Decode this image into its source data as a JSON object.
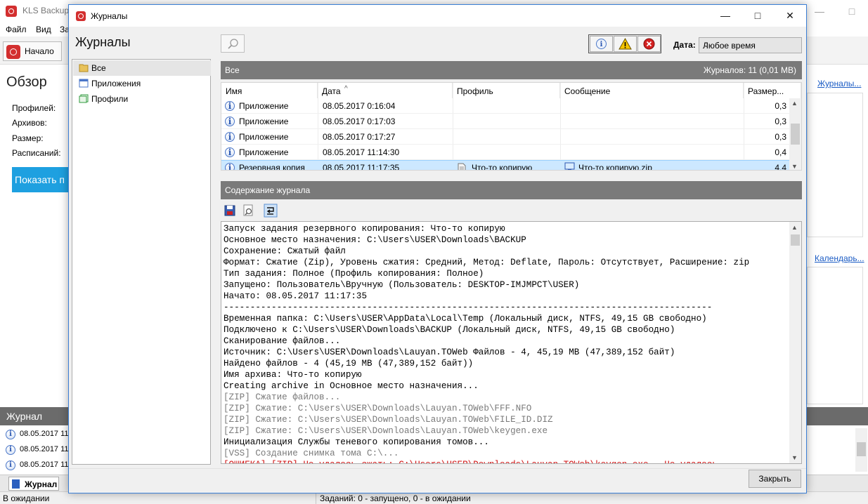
{
  "main_window": {
    "title": "KLS Backup 2",
    "menu": [
      "Файл",
      "Вид",
      "За"
    ],
    "toolbar_start": "Начало",
    "overview_title": "Обзор",
    "overview_labels": [
      "Профилей:",
      "Архивов:",
      "Размер:",
      "Расписаний:"
    ],
    "show_button": "Показать п",
    "link_journals": "Журналы...",
    "link_calendar": "Календарь...",
    "journal_panel_title": "Журнал",
    "journal_rows": [
      "08.05.2017 11",
      "08.05.2017 11",
      "08.05.2017 11"
    ],
    "tab_journal": "Журнал",
    "status_left": "В ожидании",
    "status_mid": "Заданий: 0 - запущено, 0 - в ожидании"
  },
  "dialog": {
    "title": "Журналы",
    "heading": "Журналы",
    "tree": [
      {
        "label": "Все",
        "selected": true
      },
      {
        "label": "Приложения",
        "selected": false
      },
      {
        "label": "Профили",
        "selected": false
      }
    ],
    "date_label": "Дата:",
    "date_value": "Любое время",
    "grid_title": "Все",
    "grid_summary": "Журналов: 11 (0,01 MB)",
    "columns": {
      "name": "Имя",
      "date": "Дата",
      "profile": "Профиль",
      "message": "Сообщение",
      "size": "Размер..."
    },
    "rows": [
      {
        "name": "Приложение",
        "date": "08.05.2017 0:16:04",
        "profile": "",
        "message": "",
        "size": "0,3",
        "selected": false
      },
      {
        "name": "Приложение",
        "date": "08.05.2017 0:17:03",
        "profile": "",
        "message": "",
        "size": "0,3",
        "selected": false
      },
      {
        "name": "Приложение",
        "date": "08.05.2017 0:17:27",
        "profile": "",
        "message": "",
        "size": "0,3",
        "selected": false
      },
      {
        "name": "Приложение",
        "date": "08.05.2017 11:14:30",
        "profile": "",
        "message": "",
        "size": "0,4",
        "selected": false
      },
      {
        "name": "Резервная копия",
        "date": "08.05.2017 11:17:35",
        "profile": "Что-то копирую",
        "message": "Что-то копирую.zip",
        "size": "4,4",
        "selected": true
      }
    ],
    "content_title": "Содержание журнала",
    "log_lines": [
      {
        "text": "Запуск задания резервного копирования: Что-то копирую",
        "style": "normal"
      },
      {
        "text": "Основное место назначения: C:\\Users\\USER\\Downloads\\BACKUP",
        "style": "normal"
      },
      {
        "text": "Сохранение: Сжатый файл",
        "style": "normal"
      },
      {
        "text": "Формат: Сжатие (Zip), Уровень сжатия: Средний, Метод: Deflate, Пароль: Отсутствует, Расширение: zip",
        "style": "normal"
      },
      {
        "text": "Тип задания: Полное (Профиль копирования: Полное)",
        "style": "normal"
      },
      {
        "text": "Запущено: Пользователь\\Вручную (Пользователь: DESKTOP-IMJMPCT\\USER)",
        "style": "normal"
      },
      {
        "text": "Начато: 08.05.2017 11:17:35",
        "style": "normal"
      },
      {
        "text": "--------------------------------------------------------------------------------------------",
        "style": "normal"
      },
      {
        "text": "Временная папка: C:\\Users\\USER\\AppData\\Local\\Temp (Локальный диск, NTFS, 49,15 GB свободно)",
        "style": "normal"
      },
      {
        "text": "Подключено к C:\\Users\\USER\\Downloads\\BACKUP (Локальный диск, NTFS, 49,15 GB свободно)",
        "style": "normal"
      },
      {
        "text": "Сканирование файлов...",
        "style": "normal"
      },
      {
        "text": "Источник: C:\\Users\\USER\\Downloads\\Lauyan.TOWeb Файлов - 4, 45,19 MB (47,389,152 байт)",
        "style": "normal"
      },
      {
        "text": "Найдено файлов - 4 (45,19 MB (47,389,152 байт))",
        "style": "normal"
      },
      {
        "text": "Имя архива: Что-то копирую",
        "style": "normal"
      },
      {
        "text": "Creating archive in Основное место назначения...",
        "style": "normal"
      },
      {
        "text": "[ZIP] Сжатие файлов...",
        "style": "gray"
      },
      {
        "text": "[ZIP] Сжатие: C:\\Users\\USER\\Downloads\\Lauyan.TOWeb\\FFF.NFO",
        "style": "gray"
      },
      {
        "text": "[ZIP] Сжатие: C:\\Users\\USER\\Downloads\\Lauyan.TOWeb\\FILE_ID.DIZ",
        "style": "gray"
      },
      {
        "text": "[ZIP] Сжатие: C:\\Users\\USER\\Downloads\\Lauyan.TOWeb\\keygen.exe",
        "style": "gray"
      },
      {
        "text": "Инициализация Службы теневого копирования томов...",
        "style": "normal"
      },
      {
        "text": "[VSS] Создание снимка тома C:\\...",
        "style": "gray"
      },
      {
        "text": "[ОШИБКА] [ZIP] Не удалось сжать: C:\\Users\\USER\\Downloads\\Lauyan.TOWeb\\keygen.exe - Не удалось",
        "style": "red"
      }
    ],
    "close_button": "Закрыть"
  },
  "colors": {
    "accent": "#1ea0e0",
    "selection": "#cce8ff",
    "header_gray": "#7a7a7a",
    "error_red": "#d01010",
    "brand_red": "#d32f2f"
  }
}
